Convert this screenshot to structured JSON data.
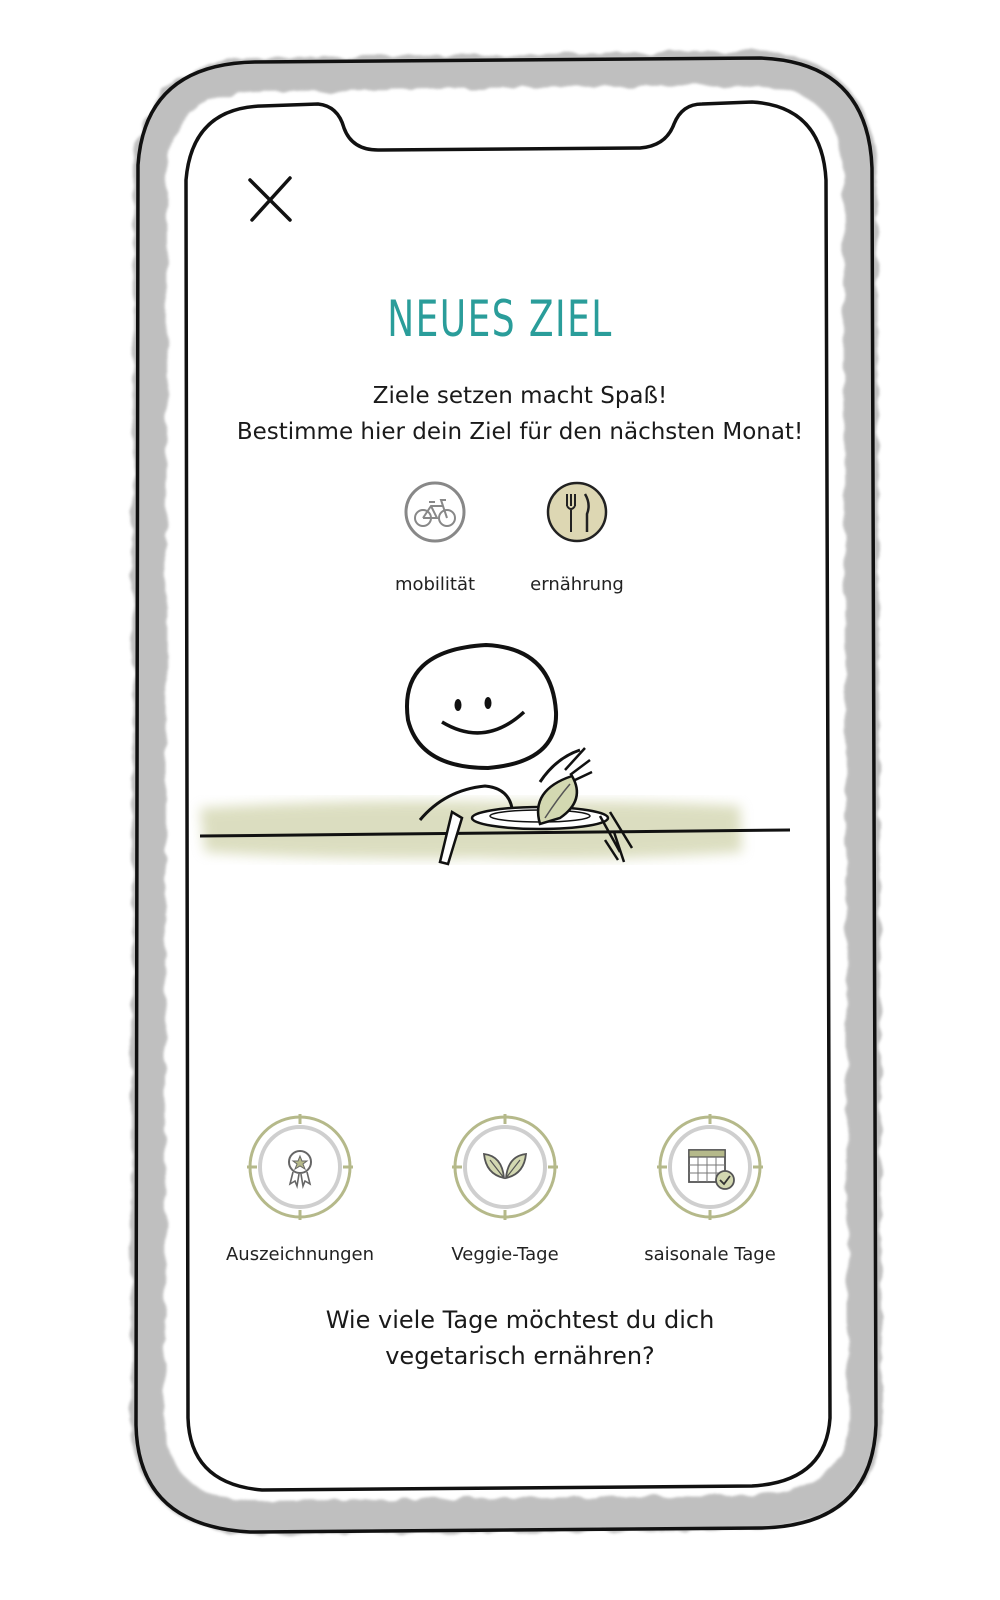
{
  "screen": {
    "title": "NEUES ZIEL",
    "subtitle_line1": "Ziele setzen macht Spaß!",
    "subtitle_line2": "Bestimme hier dein Ziel für den nächsten Monat!",
    "accent_color": "#2a9d9a",
    "selected_fill": "#ddd7b3"
  },
  "categories": [
    {
      "label": "mobilität",
      "icon": "bicycle-icon",
      "selected": false
    },
    {
      "label": "ernährung",
      "icon": "fork-knife-icon",
      "selected": true
    }
  ],
  "options": [
    {
      "label": "Auszeichnungen",
      "icon": "award-rosette-icon"
    },
    {
      "label": "Veggie-Tage",
      "icon": "leaves-icon"
    },
    {
      "label": "saisonale Tage",
      "icon": "calendar-check-icon"
    }
  ],
  "question": {
    "line1": "Wie viele Tage möchtest du dich",
    "line2": "vegetarisch ernähren?"
  }
}
